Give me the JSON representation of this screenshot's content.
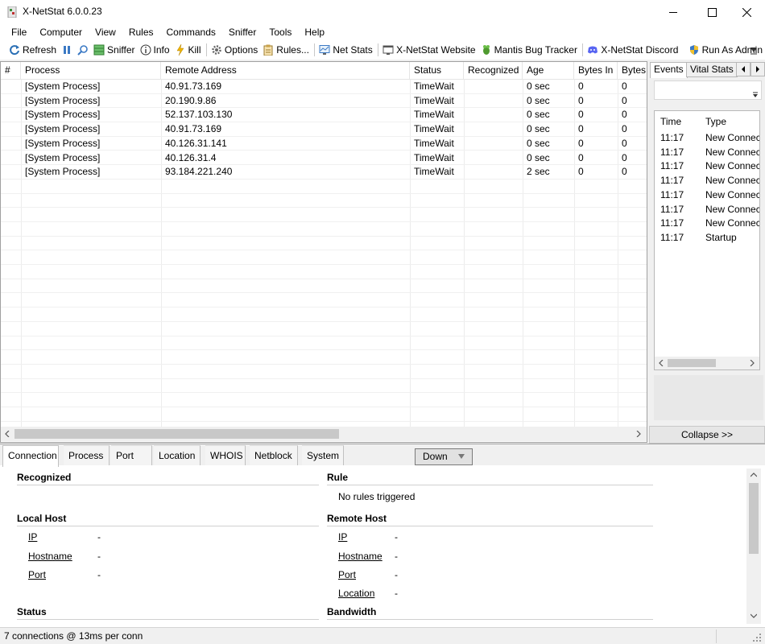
{
  "window": {
    "title": "X-NetStat 6.0.0.23",
    "minimize": "—",
    "maximize": "☐",
    "close": "✕"
  },
  "menu": [
    "File",
    "Computer",
    "View",
    "Rules",
    "Commands",
    "Sniffer",
    "Tools",
    "Help"
  ],
  "toolbar": {
    "refresh": "Refresh",
    "sniffer": "Sniffer",
    "info": "Info",
    "kill": "Kill",
    "options": "Options",
    "rules": "Rules...",
    "net_stats": "Net Stats",
    "website": "X-NetStat Website",
    "mantis": "Mantis Bug Tracker",
    "discord": "X-NetStat Discord",
    "run_as_admin": "Run As Admin"
  },
  "grid": {
    "columns": [
      "#",
      "Process",
      "Remote Address",
      "Status",
      "Recognized",
      "Age",
      "Bytes In",
      "Bytes"
    ],
    "rows": [
      {
        "process": "[System Process]",
        "remote": "40.91.73.169",
        "status": "TimeWait",
        "recognized": "",
        "age": "0 sec",
        "bytes_in": "0",
        "bytes": "0"
      },
      {
        "process": "[System Process]",
        "remote": "20.190.9.86",
        "status": "TimeWait",
        "recognized": "",
        "age": "0 sec",
        "bytes_in": "0",
        "bytes": "0"
      },
      {
        "process": "[System Process]",
        "remote": "52.137.103.130",
        "status": "TimeWait",
        "recognized": "",
        "age": "0 sec",
        "bytes_in": "0",
        "bytes": "0"
      },
      {
        "process": "[System Process]",
        "remote": "40.91.73.169",
        "status": "TimeWait",
        "recognized": "",
        "age": "0 sec",
        "bytes_in": "0",
        "bytes": "0"
      },
      {
        "process": "[System Process]",
        "remote": "40.126.31.141",
        "status": "TimeWait",
        "recognized": "",
        "age": "0 sec",
        "bytes_in": "0",
        "bytes": "0"
      },
      {
        "process": "[System Process]",
        "remote": "40.126.31.4",
        "status": "TimeWait",
        "recognized": "",
        "age": "0 sec",
        "bytes_in": "0",
        "bytes": "0"
      },
      {
        "process": "[System Process]",
        "remote": "93.184.221.240",
        "status": "TimeWait",
        "recognized": "",
        "age": "2 sec",
        "bytes_in": "0",
        "bytes": "0"
      }
    ]
  },
  "right_panel": {
    "tabs": [
      "Events",
      "Vital Stats"
    ],
    "columns": [
      "Time",
      "Type"
    ],
    "events": [
      {
        "time": "11:17",
        "type": "New Connect"
      },
      {
        "time": "11:17",
        "type": "New Connect"
      },
      {
        "time": "11:17",
        "type": "New Connect"
      },
      {
        "time": "11:17",
        "type": "New Connect"
      },
      {
        "time": "11:17",
        "type": "New Connect"
      },
      {
        "time": "11:17",
        "type": "New Connect"
      },
      {
        "time": "11:17",
        "type": "New Connect"
      },
      {
        "time": "11:17",
        "type": "Startup"
      }
    ],
    "collapse": "Collapse >>"
  },
  "bottom": {
    "tabs": [
      "Connection",
      "Process",
      "Port",
      "Location",
      "WHOIS",
      "Netblock",
      "System"
    ],
    "down_label": "Down",
    "recognized": "Recognized",
    "rule": "Rule",
    "no_rules": "No rules triggered",
    "local_host": "Local Host",
    "remote_host": "Remote Host",
    "ip": "IP",
    "hostname": "Hostname",
    "port": "Port",
    "location": "Location",
    "dash": "-",
    "status": "Status",
    "bandwidth": "Bandwidth"
  },
  "statusbar": {
    "text": "7 connections @ 13ms per conn"
  }
}
